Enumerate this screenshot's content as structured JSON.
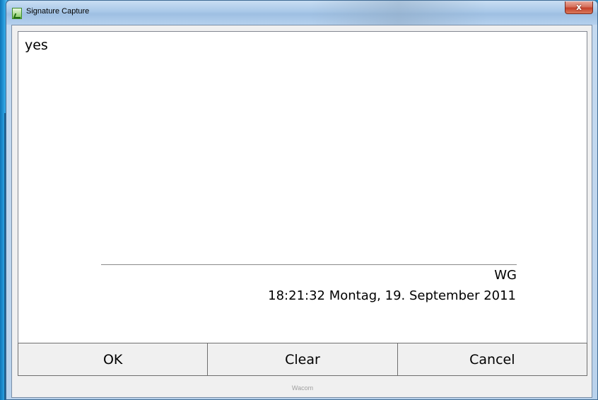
{
  "window": {
    "title": "Signature Capture",
    "close_label": "x"
  },
  "icons": {
    "app": "signature-capture-app-icon",
    "close": "close-icon"
  },
  "signature": {
    "text": "yes",
    "signer": "WG",
    "timestamp": "18:21:32 Montag, 19. September 2011"
  },
  "buttons": {
    "ok": "OK",
    "clear": "Clear",
    "cancel": "Cancel"
  },
  "footer": {
    "text": "Wacom"
  },
  "colors": {
    "desktop": "#1a8fd0",
    "close_button": "#c4402a",
    "client_background": "#f0f0f0"
  }
}
